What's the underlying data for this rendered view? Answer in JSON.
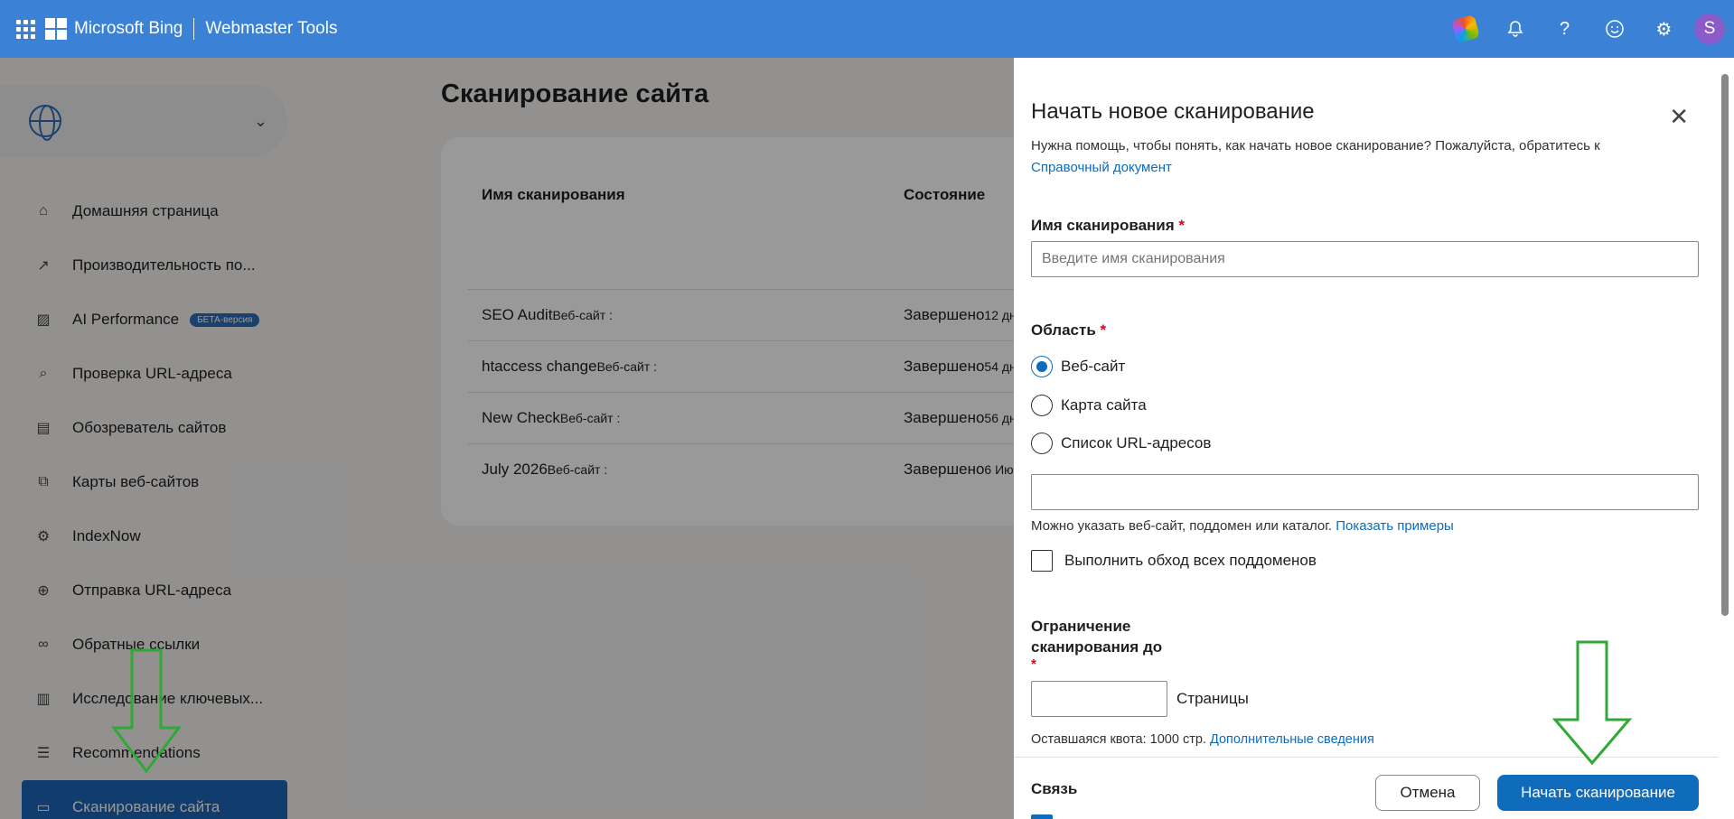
{
  "topbar": {
    "brand": "Microsoft Bing",
    "product": "Webmaster Tools",
    "avatar_letter": "S",
    "icons": [
      "apps-grid-icon",
      "copilot-icon",
      "bell-icon",
      "help-icon",
      "feedback-smiley-icon",
      "gear-icon"
    ]
  },
  "sidebar": {
    "items": [
      {
        "label": "Домашняя страница",
        "icon": "home-icon"
      },
      {
        "label": "Производительность по...",
        "icon": "trend-icon"
      },
      {
        "label": "AI Performance",
        "icon": "chart-icon",
        "badge": "БЕТА-версия"
      },
      {
        "label": "Проверка URL-адреса",
        "icon": "search-icon"
      },
      {
        "label": "Обозреватель сайтов",
        "icon": "document-icon"
      },
      {
        "label": "Карты веб-сайтов",
        "icon": "sitemap-icon"
      },
      {
        "label": "IndexNow",
        "icon": "gear-icon"
      },
      {
        "label": "Отправка URL-адреса",
        "icon": "globe-icon"
      },
      {
        "label": "Обратные ссылки",
        "icon": "link-icon"
      },
      {
        "label": "Исследование ключевых...",
        "icon": "notebook-icon"
      },
      {
        "label": "Recommendations",
        "icon": "checklist-icon"
      },
      {
        "label": "Сканирование сайта",
        "icon": "scan-icon",
        "active": true
      }
    ]
  },
  "main": {
    "title": "Сканирование сайта",
    "table": {
      "headers": [
        "Имя сканирования",
        "Состояние"
      ],
      "rows": [
        {
          "name": "SEO Audit",
          "scope": "Веб-сайт :",
          "status": "Завершено",
          "time": "12 дн"
        },
        {
          "name": "htaccess change",
          "scope": "Веб-сайт :",
          "status": "Завершено",
          "time": "54 дн"
        },
        {
          "name": "New Check",
          "scope": "Веб-сайт :",
          "status": "Завершено",
          "time": "56 дн"
        },
        {
          "name": "July 2026",
          "scope": "Веб-сайт :",
          "status": "Завершено",
          "time": "6 Ию"
        }
      ]
    }
  },
  "panel": {
    "title": "Начать новое сканирование",
    "help_text": "Нужна помощь, чтобы понять, как начать новое сканирование? Пожалуйста, обратитесь к",
    "help_link": "Справочный документ",
    "name_label": "Имя сканирования",
    "required_mark": "*",
    "name_placeholder": "Введите имя сканирования",
    "scope_label": "Область",
    "scope_options": [
      {
        "label": "Веб-сайт",
        "selected": true
      },
      {
        "label": "Карта сайта",
        "selected": false
      },
      {
        "label": "Список URL-адресов",
        "selected": false
      }
    ],
    "scope_value": "",
    "scope_hint": "Можно указать веб-сайт, поддомен или каталог.",
    "scope_hint_link": "Показать примеры",
    "subdomains_label": "Выполнить обход всех поддоменов",
    "limit_label_1": "Ограничение",
    "limit_label_2": "сканирования до",
    "limit_value": "",
    "limit_unit": "Страницы",
    "quota_text": "Оставшаяся квота: 1000 стр.",
    "quota_link": "Дополнительные сведения",
    "comm_label": "Связь",
    "cancel_label": "Отмена",
    "start_label": "Начать сканирование"
  },
  "colors": {
    "topbar": "#3b82d6",
    "primary": "#0f6cbd",
    "arrow": "#2fa836"
  }
}
